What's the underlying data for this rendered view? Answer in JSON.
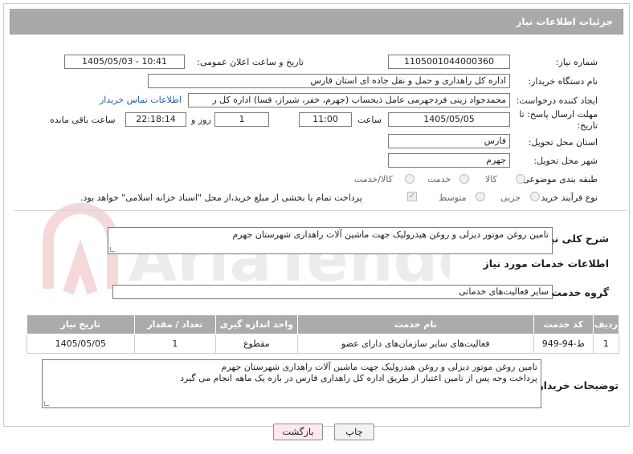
{
  "header": {
    "title": "جزئیات اطلاعات نیاز"
  },
  "fields": {
    "need_number_label": "شماره نیاز:",
    "need_number": "1105001044000360",
    "announce_label": "تاریخ و ساعت اعلان عمومی:",
    "announce_value": "1405/05/03 - 10:41",
    "buyer_org_label": "نام دستگاه خریدار:",
    "buyer_org": "اداره کل راهداری و حمل و نقل جاده ای استان فارس",
    "creator_label": "ایجاد کننده درخواست:",
    "creator": "محمدجواد زینی فردجهرمی عامل ذیحساب (جهرم، خفر، شیراز، فسا) اداره کل ر",
    "contact_link": "اطلاعات تماس خریدار",
    "deadline_label": "مهلت ارسال پاسخ: تا تاریخ:",
    "deadline_date": "1405/05/05",
    "hour_label": "ساعت",
    "deadline_time": "11:00",
    "days_value": "1",
    "days_label": "روز و",
    "remaining_time": "22:18:14",
    "remaining_label": "ساعت باقی مانده",
    "province_label": "استان محل تحویل:",
    "province": "فارس",
    "city_label": "شهر محل تحویل:",
    "city": "جهرم",
    "category_label": "طبقه بندی موضوعی:",
    "category_options": [
      "کالا",
      "خدمت",
      "کالا/خدمت"
    ],
    "process_label": "نوع فرآیند خرید :",
    "process_options": [
      "جزیی",
      "متوسط"
    ],
    "payment_note": "پرداخت تمام یا بخشی از مبلغ خرید،از محل \"اسناد خزانه اسلامی\" خواهد بود."
  },
  "summary": {
    "label": "شرح کلی نیاز:",
    "text": "تامین روغن موتور دیزلی و روغن هیدرولیک جهت ماشین آلات راهداری شهرستان جهرم"
  },
  "services": {
    "section_title": "اطلاعات خدمات مورد نیاز",
    "group_label": "گروه خدمت:",
    "group_value": "سایر فعالیت‌های خدماتی",
    "columns": [
      "ردیف",
      "کد خدمت",
      "نام خدمت",
      "واحد اندازه گیری",
      "تعداد / مقدار",
      "تاریخ نیاز"
    ],
    "rows": [
      [
        "1",
        "ط-94-949",
        "فعالیت‌های سایر سازمان‌های دارای عضو",
        "مقطوع",
        "1",
        "1405/05/05"
      ]
    ]
  },
  "buyer_notes": {
    "label": "توضیحات خریدار:",
    "line1": "تامین روغن موتور دیزلی و روغن هیدرولیک جهت ماشین آلات راهداری شهرستان جهرم",
    "line2": "پرداخت وجه پس از تامین اعتبار از طریق اداره کل راهداری فارس در بازه یک ماهه انجام می گیرد"
  },
  "buttons": {
    "print": "چاپ",
    "back": "بازگشت"
  },
  "watermark": {
    "text": "AriaTender.neT"
  },
  "colors": {
    "header_bg": "#a9a9a9",
    "link": "#1f5fa8",
    "back_button_bg": "#fde8ea"
  }
}
